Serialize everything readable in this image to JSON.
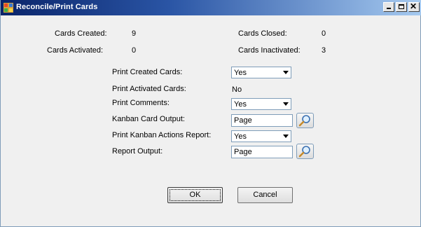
{
  "window": {
    "title": "Reconcile/Print Cards"
  },
  "stats": {
    "cards_created_label": "Cards Created:",
    "cards_created_value": "9",
    "cards_closed_label": "Cards Closed:",
    "cards_closed_value": "0",
    "cards_activated_label": "Cards Activated:",
    "cards_activated_value": "0",
    "cards_inactivated_label": "Cards Inactivated:",
    "cards_inactivated_value": "3"
  },
  "options": {
    "print_created_label": "Print Created Cards:",
    "print_created_value": "Yes",
    "print_activated_label": "Print Activated Cards:",
    "print_activated_value": "No",
    "print_comments_label": "Print Comments:",
    "print_comments_value": "Yes",
    "kanban_output_label": "Kanban Card Output:",
    "kanban_output_value": "Page",
    "print_actions_label": "Print Kanban Actions Report:",
    "print_actions_value": "Yes",
    "report_output_label": "Report Output:",
    "report_output_value": "Page"
  },
  "buttons": {
    "ok": "OK",
    "cancel": "Cancel"
  },
  "icons": {
    "app": "app-icon",
    "lookup": "magnifier-icon"
  }
}
